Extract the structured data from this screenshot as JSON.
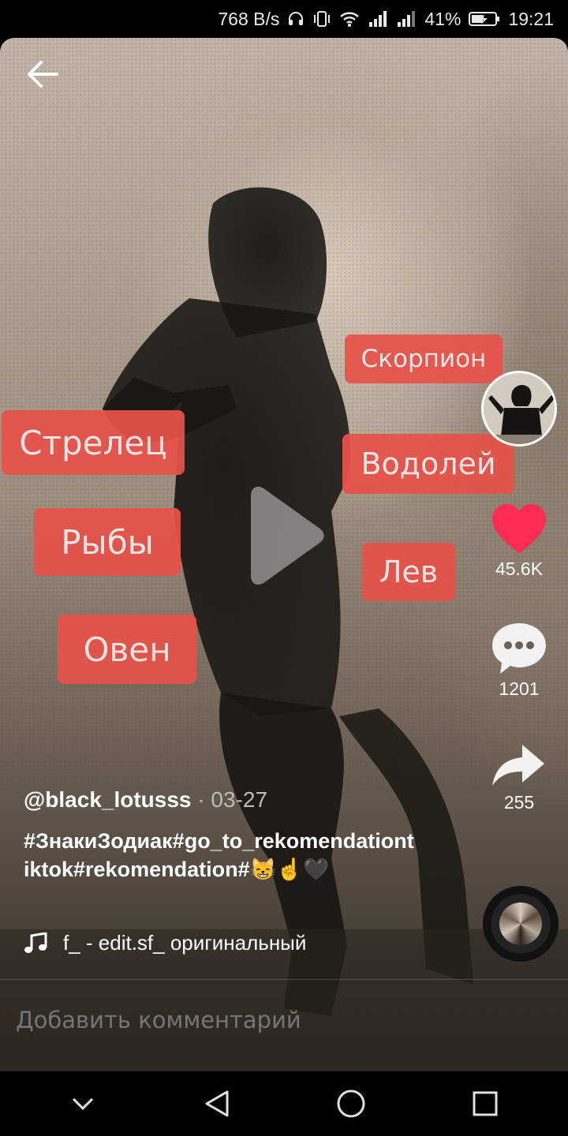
{
  "status_bar": {
    "network_speed": "768 B/s",
    "battery_percent": "41%",
    "time": "19:21",
    "icons": [
      "headphones-icon",
      "vibrate-icon",
      "wifi-icon",
      "signal-icon",
      "signal-icon",
      "battery-charging-icon"
    ]
  },
  "video": {
    "back_icon": "arrow-left-icon",
    "play_icon": "play-icon",
    "overlay_tags": [
      "Скорпион",
      "Стрелец",
      "Водолей",
      "Рыбы",
      "Лев",
      "Овен"
    ]
  },
  "sidebar": {
    "like_count": "45.6K",
    "comment_count": "1201",
    "share_count": "255",
    "like_color": "#fe2c55"
  },
  "post": {
    "username": "@black_lotusss",
    "date": "· 03-27",
    "caption": "#ЗнакиЗодиак#go_to_rekomendationtiktok#rekomendation#😸☝🖤",
    "music_text": "f_ - edit.sf_ оригинальный"
  },
  "comment_bar": {
    "placeholder": "Добавить комментарий"
  },
  "nav_bar": {
    "icons": [
      "chevron-down-icon",
      "back-triangle-icon",
      "home-circle-icon",
      "recents-square-icon"
    ]
  }
}
